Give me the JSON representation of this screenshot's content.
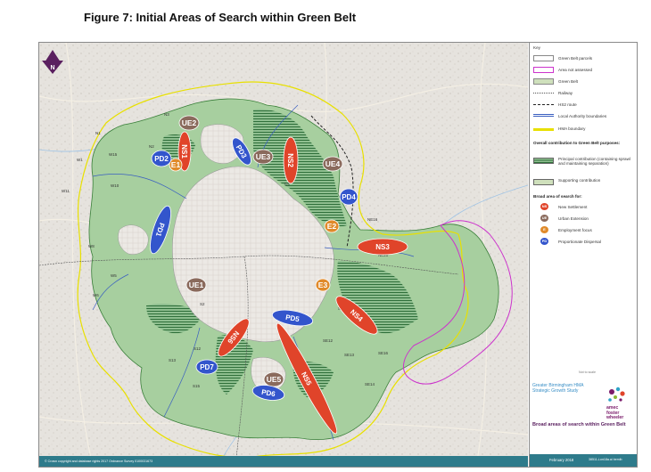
{
  "title": "Figure 7:   Initial Areas of Search within Green Belt",
  "north_label": "N",
  "legend": {
    "header": "Key",
    "items": [
      {
        "label": "Green Belt parcels",
        "fill": "#ffffff",
        "stroke": "#888888"
      },
      {
        "label": "Area not assessed",
        "fill": "#ffffff",
        "stroke": "#cc33cc"
      },
      {
        "label": "Green Belt",
        "fill": "#cfe0bc",
        "stroke": "#888888"
      },
      {
        "label": "Railway",
        "fill": "none",
        "stroke": "#555555"
      },
      {
        "label": "HS2 route",
        "fill": "none",
        "stroke": "#222222"
      },
      {
        "label": "Local Authority boundaries",
        "fill": "none",
        "stroke": "#3a5fc0"
      },
      {
        "label": "HMA boundary",
        "fill": "none",
        "stroke": "#e8e000"
      }
    ],
    "overall_title": "Overall contribution to Green Belt purposes:",
    "overall_items": [
      {
        "label": "Principal contribution (containing sprawl and maintaining separation)"
      },
      {
        "label": "Supporting contribution"
      }
    ],
    "broad_title": "Broad area of search for:",
    "broad_items": [
      {
        "code": "NS",
        "label": "New Settlement",
        "color": "#e0442a"
      },
      {
        "code": "UE",
        "label": "Urban Extension",
        "color": "#8a6a5c"
      },
      {
        "code": "E",
        "label": "Employment focus",
        "color": "#e08a2a"
      },
      {
        "code": "PD",
        "label": "Proportionate Dispersal",
        "color": "#3355cc"
      }
    ],
    "scale_note": "Not to scale",
    "study_name": "Greater Birmingham HMA Strategic Growth Study",
    "logo_text": "amec\nfoster\nwheeler",
    "map_subtitle": "Broad areas of search within Green Belt",
    "date": "February 2018",
    "ref": "38511-Lon18a.ai bemib",
    "copyright": "© Crown copyright and database rights 2017 Ordnance Survey 0100031673"
  },
  "areas": [
    {
      "code": "NS1",
      "type": "NS"
    },
    {
      "code": "NS2",
      "type": "NS"
    },
    {
      "code": "NS3",
      "type": "NS"
    },
    {
      "code": "NS4",
      "type": "NS"
    },
    {
      "code": "NS5",
      "type": "NS"
    },
    {
      "code": "NS6",
      "type": "NS"
    },
    {
      "code": "UE1",
      "type": "UE"
    },
    {
      "code": "UE2",
      "type": "UE"
    },
    {
      "code": "UE3",
      "type": "UE"
    },
    {
      "code": "UE4",
      "type": "UE"
    },
    {
      "code": "UE5",
      "type": "UE"
    },
    {
      "code": "E1",
      "type": "E"
    },
    {
      "code": "E2",
      "type": "E"
    },
    {
      "code": "E3",
      "type": "E"
    },
    {
      "code": "PD1",
      "type": "PD"
    },
    {
      "code": "PD2",
      "type": "PD"
    },
    {
      "code": "PD3",
      "type": "PD"
    },
    {
      "code": "PD4",
      "type": "PD"
    },
    {
      "code": "PD5",
      "type": "PD"
    },
    {
      "code": "PD6",
      "type": "PD"
    },
    {
      "code": "PD7",
      "type": "PD"
    }
  ],
  "parcels": [
    "N1",
    "N2",
    "N3",
    "W1",
    "W10",
    "W11",
    "W15",
    "W5",
    "W6",
    "W8",
    "NE8",
    "NE16",
    "NE20",
    "C4",
    "S2",
    "S12",
    "S13",
    "S15",
    "SE12",
    "SE13",
    "SE14",
    "SE16",
    "SE5",
    "S36"
  ]
}
